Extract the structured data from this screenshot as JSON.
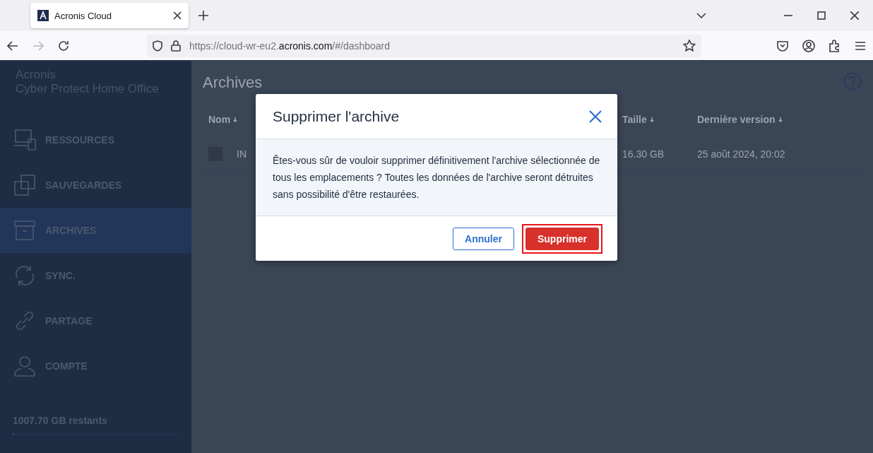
{
  "browser": {
    "tab": {
      "title": "Acronis Cloud"
    },
    "nav": {
      "forward_disabled": true
    },
    "url": {
      "prefix": "https://cloud-wr-eu2.",
      "host": "acronis.com",
      "path": "/#/dashboard"
    }
  },
  "sidebar": {
    "brand": {
      "name": "Acronis",
      "product": "Cyber Protect Home Office"
    },
    "items": [
      {
        "label": "RESSOURCES",
        "kind": "devices",
        "selected": false
      },
      {
        "label": "SAUVEGARDES",
        "kind": "copies",
        "selected": false
      },
      {
        "label": "ARCHIVES",
        "kind": "archive",
        "selected": true
      },
      {
        "label": "SYNC.",
        "kind": "sync",
        "selected": false
      },
      {
        "label": "PARTAGE",
        "kind": "link",
        "selected": false
      },
      {
        "label": "COMPTE",
        "kind": "user",
        "selected": false
      }
    ],
    "storage": {
      "text": "1007.70 GB restants",
      "level": 0.01
    }
  },
  "main": {
    "title": "Archives",
    "columns": [
      "Nom",
      "Taille",
      "Dernière version"
    ],
    "rows": [
      {
        "name": "IN",
        "size": "16.30 GB",
        "date": "25 août 2024, 20:02"
      }
    ]
  },
  "dialog": {
    "title": "Supprimer l'archive",
    "message": "Êtes-vous sûr de vouloir supprimer définitivement l'archive sélectionnée de tous les emplacements ? Toutes les données de l'archive seront détruites sans possibilité d'être restaurées.",
    "buttons": [
      {
        "label": "Annuler",
        "kind": "secondary",
        "highlighted": false
      },
      {
        "label": "Supprimer",
        "kind": "danger",
        "highlighted": true
      }
    ]
  }
}
